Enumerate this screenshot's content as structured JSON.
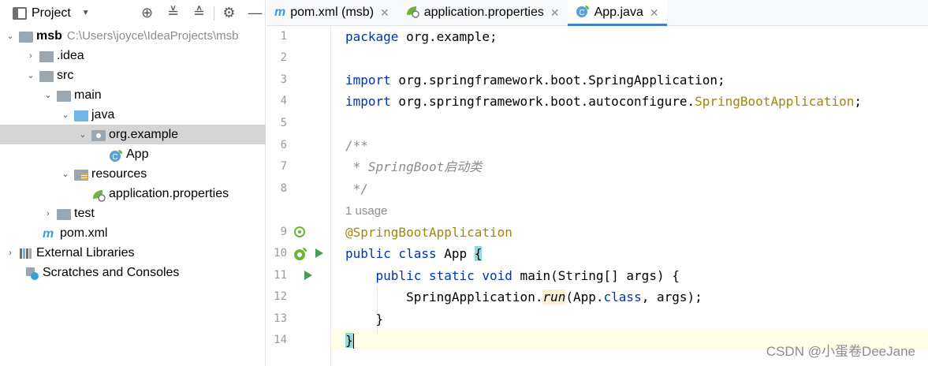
{
  "project_panel": {
    "title": "Project",
    "tree": [
      {
        "label": "msb",
        "hint": "C:\\Users\\joyce\\IdeaProjects\\msb"
      },
      {
        "label": ".idea"
      },
      {
        "label": "src"
      },
      {
        "label": "main"
      },
      {
        "label": "java"
      },
      {
        "label": "org.example"
      },
      {
        "label": "App"
      },
      {
        "label": "resources"
      },
      {
        "label": "application.properties"
      },
      {
        "label": "test"
      },
      {
        "label": "pom.xml"
      },
      {
        "label": "External Libraries"
      },
      {
        "label": "Scratches and Consoles"
      }
    ]
  },
  "tabs": [
    {
      "label": "pom.xml (msb)"
    },
    {
      "label": "application.properties"
    },
    {
      "label": "App.java"
    }
  ],
  "editor": {
    "line_numbers": [
      "1",
      "2",
      "3",
      "4",
      "5",
      "6",
      "7",
      "8",
      "9",
      "10",
      "11",
      "12",
      "13",
      "14"
    ],
    "usage_hint": "1 usage",
    "code": {
      "l1_kw": "package",
      "l1_rest": " org.example;",
      "l3_kw": "import",
      "l3_rest": " org.springframework.boot.SpringApplication;",
      "l4_kw": "import",
      "l4_rest": " org.springframework.boot.autoconfigure.",
      "l4_ann": "SpringBootApplication",
      "l4_end": ";",
      "l6": "/**",
      "l7": " * SpringBoot启动类",
      "l8": " */",
      "l9": "@SpringBootApplication",
      "l10_kw": "public class",
      "l10_rest": " App ",
      "l10_brace": "{",
      "l11_kw": "    public static void",
      "l11_rest": " main(String[] args) {",
      "l12_a": "        SpringApplication.",
      "l12_b": "run",
      "l12_c": "(App.",
      "l12_kw": "class",
      "l12_d": ", args);",
      "l13": "    }",
      "l14": "}"
    }
  },
  "watermark": "CSDN @小蛋卷DeeJane"
}
